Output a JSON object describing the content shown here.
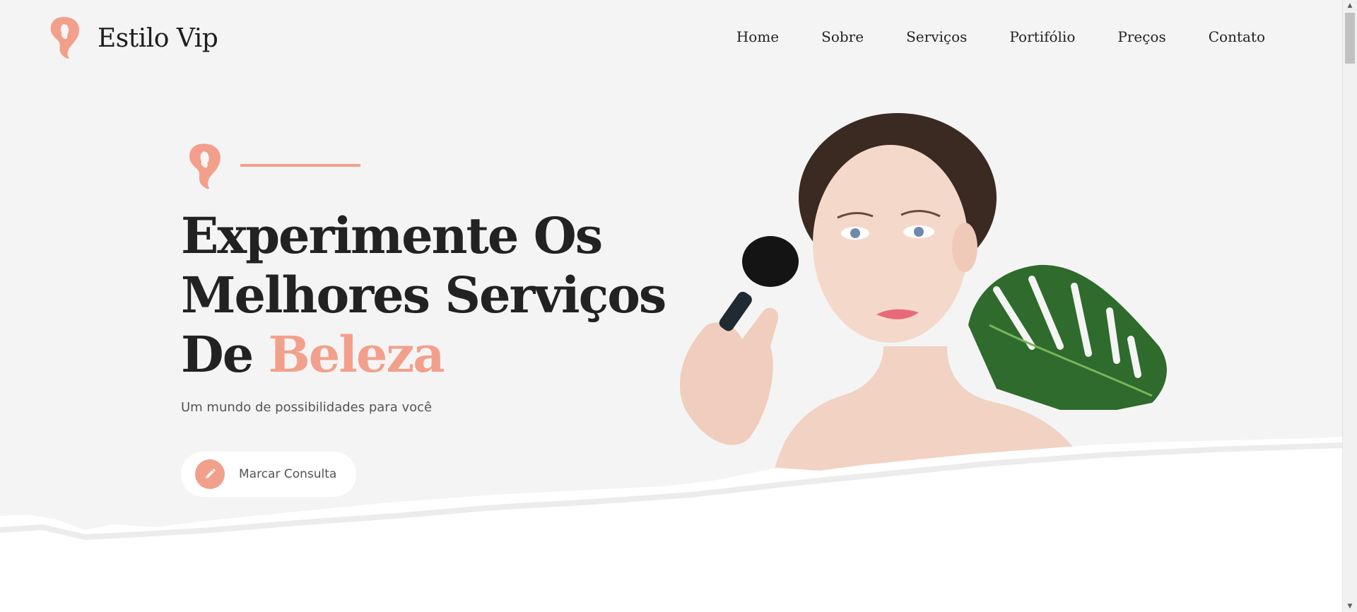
{
  "brand": {
    "name": "Estilo Vip",
    "logo_icon": "woman-profile-icon",
    "accent_color": "#f2a08c"
  },
  "nav": {
    "items": [
      {
        "label": "Home"
      },
      {
        "label": "Sobre"
      },
      {
        "label": "Serviços"
      },
      {
        "label": "Portifólio"
      },
      {
        "label": "Preços"
      },
      {
        "label": "Contato"
      }
    ]
  },
  "hero": {
    "title_line1": "Experimente Os",
    "title_line2": "Melhores Serviços",
    "title_line3_prefix": "De ",
    "title_line3_accent": "Beleza",
    "subtitle": "Um mundo de possibilidades para você",
    "cta_label": "Marcar Consulta",
    "cta_icon": "pencil-icon"
  },
  "colors": {
    "background": "#f5f4f4",
    "text_dark": "#222222",
    "text_muted": "#555555"
  }
}
